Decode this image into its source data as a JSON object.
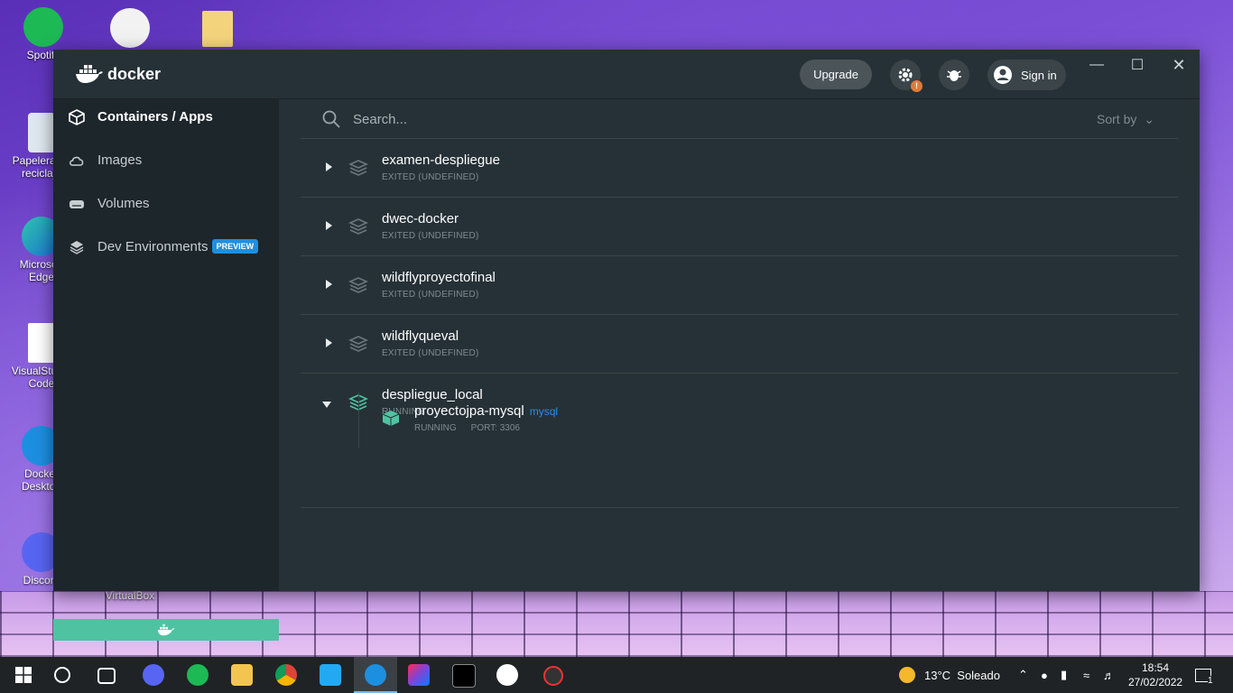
{
  "desktop": {
    "icons": [
      {
        "label": "Spotify"
      },
      {
        "label": "Papelera de reciclaje"
      },
      {
        "label": "Microsoft Edge"
      },
      {
        "label": "VisualStudio Code"
      },
      {
        "label": "Docker Desktop"
      },
      {
        "label": "Discord"
      },
      {
        "label": "VirtualBox"
      }
    ]
  },
  "window": {
    "app_name": "docker",
    "upgrade_label": "Upgrade",
    "signin_label": "Sign in",
    "settings_badge": "!"
  },
  "sidebar": {
    "items": [
      {
        "label": "Containers / Apps",
        "icon": "containers-icon",
        "active": true
      },
      {
        "label": "Images",
        "icon": "cloud-icon"
      },
      {
        "label": "Volumes",
        "icon": "volume-icon"
      },
      {
        "label": "Dev Environments",
        "icon": "dev-env-icon",
        "badge": "PREVIEW"
      }
    ]
  },
  "main": {
    "search_placeholder": "Search...",
    "sort_label": "Sort by",
    "apps": [
      {
        "name": "examen-despliegue",
        "status": "EXITED (UNDEFINED)",
        "expanded": false
      },
      {
        "name": "dwec-docker",
        "status": "EXITED (UNDEFINED)",
        "expanded": false
      },
      {
        "name": "wildflyproyectofinal",
        "status": "EXITED (UNDEFINED)",
        "expanded": false
      },
      {
        "name": "wildflyqueval",
        "status": "EXITED (UNDEFINED)",
        "expanded": false
      },
      {
        "name": "despliegue_local",
        "status": "RUNNING",
        "expanded": true,
        "containers": [
          {
            "name": "proyectojpa-mysql",
            "image": "mysql",
            "status": "RUNNING",
            "port": "PORT: 3306"
          }
        ]
      }
    ]
  },
  "taskbar": {
    "weather": "13°C  Soleado",
    "time": "18:54",
    "date": "27/02/2022",
    "notification_count": "1"
  },
  "colors": {
    "accent": "#4fc3a1",
    "window_bg": "#263137",
    "sidebar_bg": "#1d262b",
    "link_blue": "#2a8cf0"
  }
}
